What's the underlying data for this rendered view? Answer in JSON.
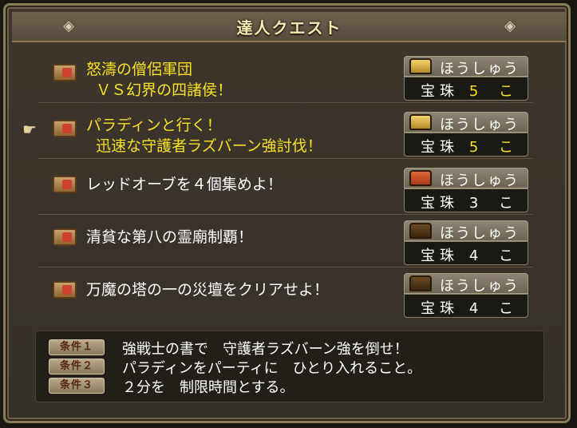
{
  "window": {
    "title": "達人クエスト",
    "corner_icon_left": "diamond-arrow-icon",
    "corner_icon_right": "diamond-arrow-icon"
  },
  "quests": [
    {
      "line1": "怒濤の僧侶軍団",
      "line2": "  ＶＳ幻界の四諸侯！",
      "color": "#f7e024",
      "reward_label": "ほうしゅう",
      "reward_item": "宝珠",
      "reward_count": "5 こ",
      "chest": "gold-chest-icon",
      "count_color": "#f7e024"
    },
    {
      "line1": "パラディンと行く！",
      "line2": "  迅速な守護者ラズバーン強討伐！",
      "color": "#f7e024",
      "reward_label": "ほうしゅう",
      "reward_item": "宝珠",
      "reward_count": "5 こ",
      "chest": "gold-chest-icon",
      "count_color": "#f7e024"
    },
    {
      "line1": "レッドオーブを４個集めよ！",
      "line2": "",
      "color": "#ffffff",
      "reward_label": "ほうしゅう",
      "reward_item": "宝珠",
      "reward_count": "3 こ",
      "chest": "red-chest-icon",
      "count_color": "#ffffff"
    },
    {
      "line1": "清貧な第八の霊廟制覇！",
      "line2": "",
      "color": "#ffffff",
      "reward_label": "ほうしゅう",
      "reward_item": "宝珠",
      "reward_count": "4 こ",
      "chest": "dark-chest-icon",
      "count_color": "#ffffff"
    },
    {
      "line1": "万魔の塔の一の災壇をクリアせよ！",
      "line2": "",
      "color": "#ffffff",
      "reward_label": "ほうしゅう",
      "reward_item": "宝珠",
      "reward_count": "4 こ",
      "chest": "dark-chest-icon",
      "count_color": "#ffffff"
    }
  ],
  "conditions": [
    {
      "badge": "条件１",
      "text": "強戦士の書で　守護者ラズバーン強を倒せ！"
    },
    {
      "badge": "条件２",
      "text": "パラディンをパーティに　ひとり入れること。"
    },
    {
      "badge": "条件３",
      "text": "２分を　制限時間とする。"
    }
  ],
  "selection_cursor": "pointing-hand-icon"
}
